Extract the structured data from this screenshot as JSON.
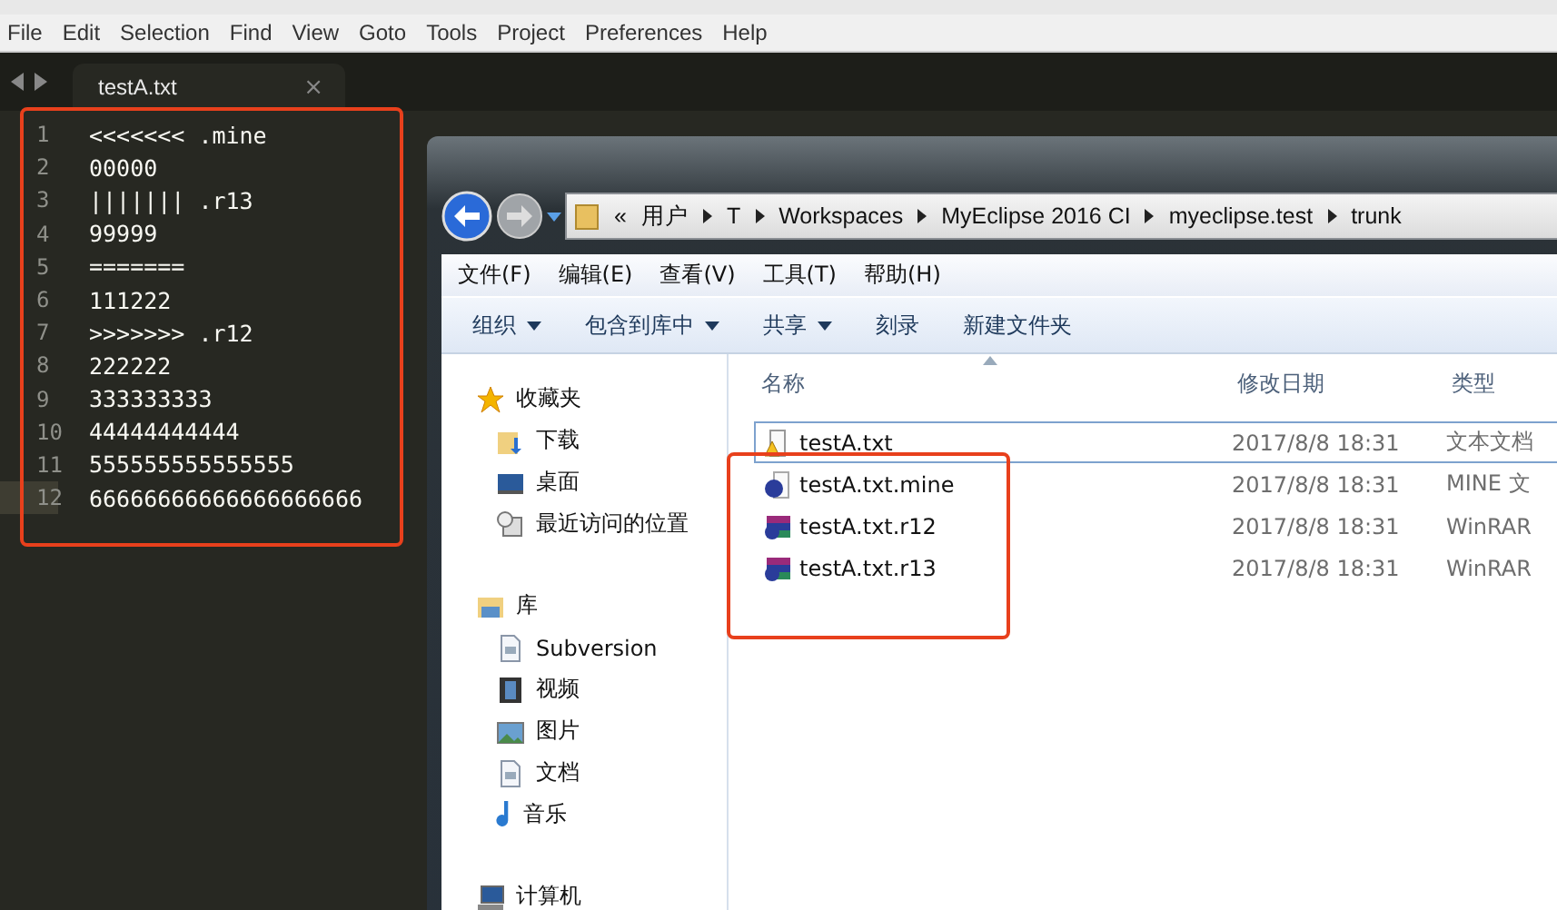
{
  "menu_bar": [
    "File",
    "Edit",
    "Selection",
    "Find",
    "View",
    "Goto",
    "Tools",
    "Project",
    "Preferences",
    "Help"
  ],
  "tabs": [
    {
      "label": "testA.txt",
      "selected": true,
      "close": "×"
    }
  ],
  "editor": {
    "lines": [
      {
        "number": "1",
        "text": "<<<<<<< .mine",
        "current": false
      },
      {
        "number": "2",
        "text": "00000",
        "current": false
      },
      {
        "number": "3",
        "text": "||||||| .r13",
        "current": false
      },
      {
        "number": "4",
        "text": "99999",
        "current": false
      },
      {
        "number": "5",
        "text": "=======",
        "current": false
      },
      {
        "number": "6",
        "text": "111222",
        "current": false
      },
      {
        "number": "7",
        "text": ">>>>>>> .r12",
        "current": false
      },
      {
        "number": "8",
        "text": "222222",
        "current": false
      },
      {
        "number": "9",
        "text": "333333333",
        "current": false
      },
      {
        "number": "10",
        "text": "44444444444",
        "current": false
      },
      {
        "number": "11",
        "text": "555555555555555",
        "current": false
      },
      {
        "number": "12",
        "text": "66666666666666666666",
        "current": true
      }
    ]
  },
  "explorer": {
    "address": {
      "overflow": "«",
      "crumbs": [
        "用户",
        "T",
        "Workspaces",
        "MyEclipse 2016 CI",
        "myeclipse.test",
        "trunk"
      ]
    },
    "menu": [
      "文件(F)",
      "编辑(E)",
      "查看(V)",
      "工具(T)",
      "帮助(H)"
    ],
    "toolbar": [
      {
        "label": "组织",
        "dropdown": true
      },
      {
        "label": "包含到库中",
        "dropdown": true
      },
      {
        "label": "共享",
        "dropdown": true
      },
      {
        "label": "刻录",
        "dropdown": false
      },
      {
        "label": "新建文件夹",
        "dropdown": false
      }
    ],
    "nav": [
      {
        "label": "收藏夹",
        "kind": "star",
        "children": [
          {
            "label": "下载",
            "kind": "download"
          },
          {
            "label": "桌面",
            "kind": "desktop"
          },
          {
            "label": "最近访问的位置",
            "kind": "recent"
          }
        ]
      },
      {
        "label": "库",
        "kind": "library",
        "children": [
          {
            "label": "Subversion",
            "kind": "doc"
          },
          {
            "label": "视频",
            "kind": "video"
          },
          {
            "label": "图片",
            "kind": "picture"
          },
          {
            "label": "文档",
            "kind": "doc"
          },
          {
            "label": "音乐",
            "kind": "music"
          }
        ]
      },
      {
        "label": "计算机",
        "kind": "computer"
      }
    ],
    "columns": [
      "名称",
      "修改日期",
      "类型"
    ],
    "files": [
      {
        "name": "testA.txt",
        "date": "2017/8/8 18:31",
        "type": "文本文档",
        "kind": "text-warning",
        "focused": true
      },
      {
        "name": "testA.txt.mine",
        "date": "2017/8/8 18:31",
        "type": "MINE 文",
        "kind": "unknown",
        "focused": false
      },
      {
        "name": "testA.txt.r12",
        "date": "2017/8/8 18:31",
        "type": "WinRAR",
        "kind": "archive",
        "focused": false
      },
      {
        "name": "testA.txt.r13",
        "date": "2017/8/8 18:31",
        "type": "WinRAR",
        "kind": "archive",
        "focused": false
      }
    ]
  }
}
